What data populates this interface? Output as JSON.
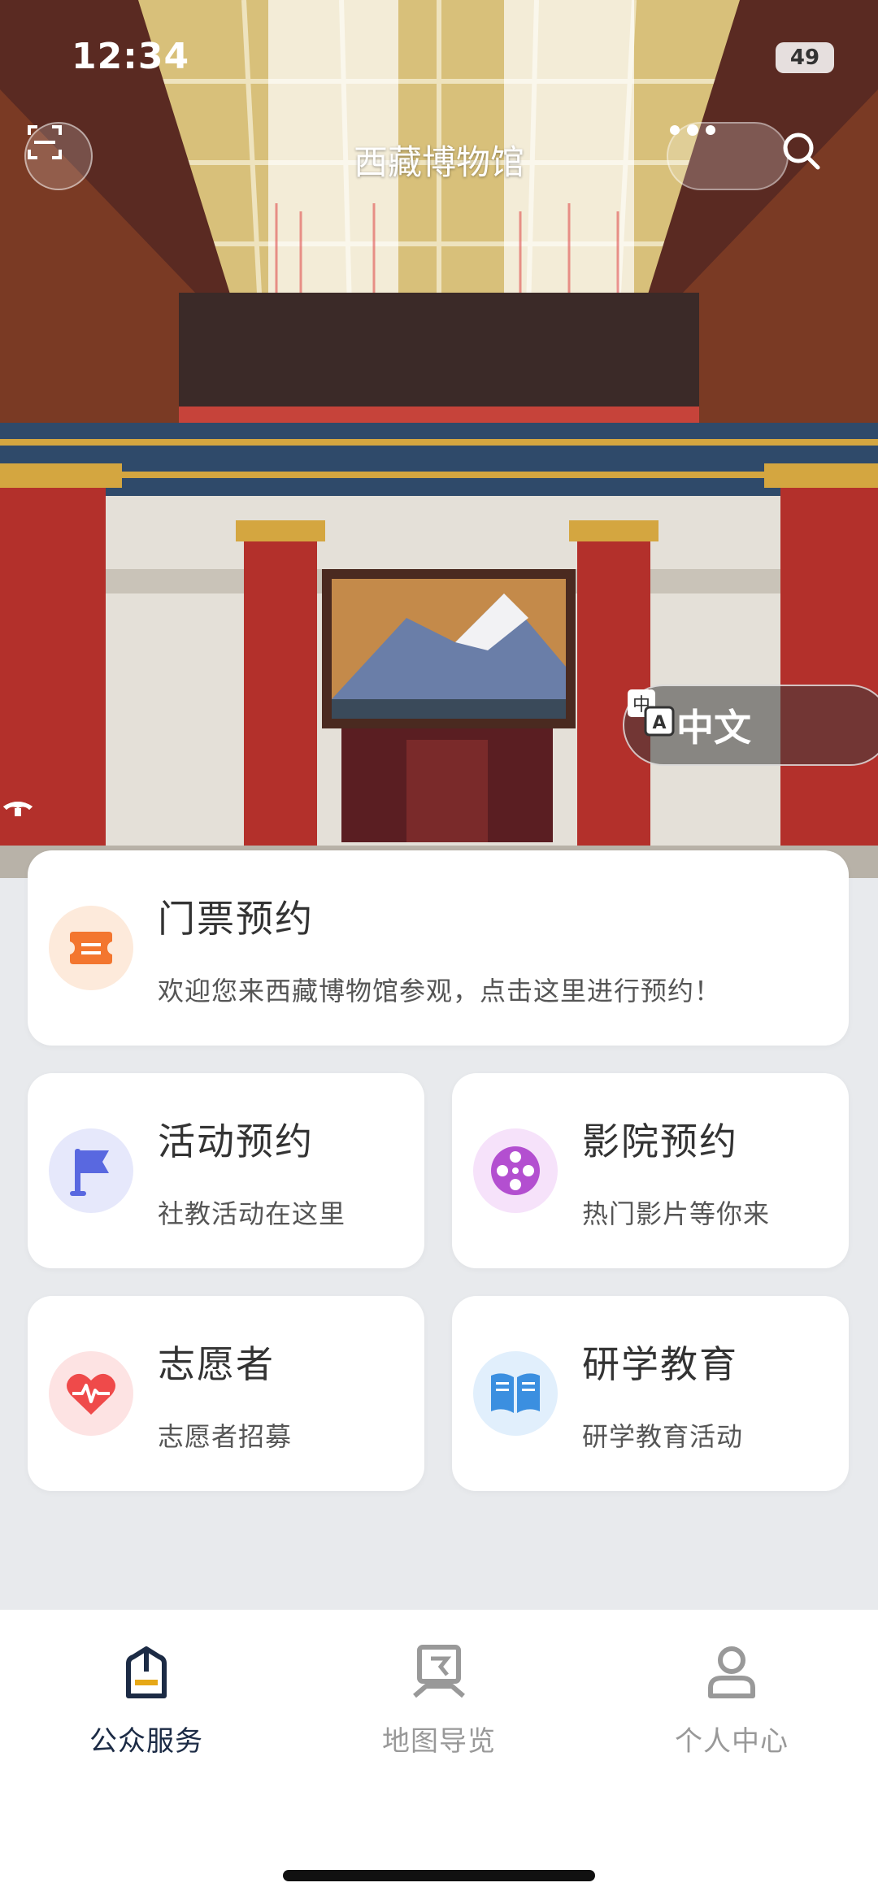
{
  "status_bar": {
    "time": "12:34",
    "battery": "49"
  },
  "nav": {
    "title": "西藏博物馆"
  },
  "language_toggle": {
    "label": "中文"
  },
  "carousel": {
    "slide_count": 3,
    "active_index": 0,
    "active_color": "#e6a817",
    "inactive_color": "#ffffff"
  },
  "cards": {
    "ticket": {
      "title": "门票预约",
      "subtitle": "欢迎您来西藏博物馆参观，点击这里进行预约！",
      "icon": "ticket-icon"
    },
    "activity": {
      "title": "活动预约",
      "subtitle": "社教活动在这里",
      "icon": "flag-icon"
    },
    "cinema": {
      "title": "影院预约",
      "subtitle": "热门影片等你来",
      "icon": "film-reel-icon"
    },
    "volunteer": {
      "title": "志愿者",
      "subtitle": "志愿者招募",
      "icon": "heart-pulse-icon"
    },
    "study": {
      "title": "研学教育",
      "subtitle": "研学教育活动",
      "icon": "book-icon"
    }
  },
  "tabbar": {
    "items": [
      {
        "label": "公众服务",
        "icon": "services-icon",
        "active": true
      },
      {
        "label": "地图导览",
        "icon": "map-guide-icon",
        "active": false
      },
      {
        "label": "个人中心",
        "icon": "profile-icon",
        "active": false
      }
    ]
  },
  "colors": {
    "primary_dark": "#1c2b45",
    "accent_orange": "#f3762f",
    "accent_purple": "#b34fd0",
    "accent_red": "#ef4a4a",
    "accent_blue": "#3b8fe0",
    "accent_indigo": "#5968e0"
  }
}
